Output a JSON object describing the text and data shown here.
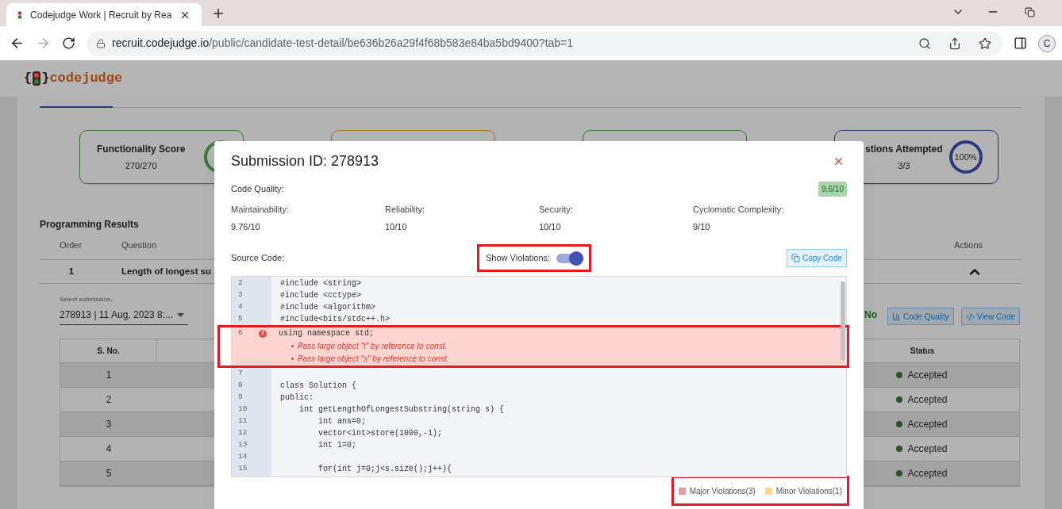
{
  "browser": {
    "tab_title": "Codejudge Work | Recruit by Rea",
    "url_host": "recruit.codejudge.io",
    "url_path": "/public/candidate-test-detail/be636b26a29f4f68b583e84ba5bd9400?tab=1",
    "forward_disabled": true,
    "profile_initial": "C"
  },
  "page": {
    "logo": {
      "open": "{",
      "close": "}",
      "name": "codejudge"
    },
    "score_cards": [
      {
        "title": "Functionality Score",
        "value": "270/270",
        "color": "#357a38"
      },
      {
        "color": "#a87016"
      },
      {
        "color": "#357a38"
      },
      {
        "title": "stions Attempted",
        "value": "3/3",
        "ring": "100%",
        "color": "#2c397f"
      }
    ],
    "section_title": "Programming Results",
    "results_columns": [
      "Order",
      "Question",
      "Actions"
    ],
    "results_row": {
      "order": "1",
      "question": "Length of longest su",
      "expanded": true
    },
    "submission_select": {
      "label": "Select submission..",
      "value": "278913 | 11 Aug, 2023 8:..."
    },
    "row_flag": "No",
    "action_buttons": [
      {
        "label": "Code Quality",
        "kind": "quality"
      },
      {
        "label": "View Code",
        "kind": "code"
      }
    ],
    "testcase_columns": [
      "S. No.",
      "Status"
    ],
    "testcase_rows": [
      {
        "s_no": "1",
        "status": "Accepted"
      },
      {
        "s_no": "2",
        "status": "Accepted"
      },
      {
        "s_no": "3",
        "status": "Accepted"
      },
      {
        "s_no": "4",
        "status": "Accepted"
      },
      {
        "s_no": "5",
        "status": "Accepted"
      }
    ]
  },
  "modal": {
    "title": "Submission ID: 278913",
    "code_quality_label": "Code Quality:",
    "code_quality_score": "9.6/10",
    "metrics": [
      {
        "label": "Maintainability:",
        "value": "9.76/10"
      },
      {
        "label": "Reliability:",
        "value": "10/10"
      },
      {
        "label": "Security:",
        "value": "10/10"
      },
      {
        "label": "Cyclomatic Complexity:",
        "value": "9/10"
      }
    ],
    "source_label": "Source Code:",
    "show_violations": {
      "label": "Show Violations:",
      "on": true
    },
    "copy_button": "Copy Code",
    "code_lines": [
      {
        "kind": "plain",
        "number": "2",
        "code": "#include <string>"
      },
      {
        "kind": "plain",
        "number": "3",
        "code": "#include <cctype>"
      },
      {
        "kind": "plain",
        "number": "4",
        "code": "#include <algorithm>"
      },
      {
        "kind": "plain",
        "number": "5",
        "code": "#include<bits/stdc++.h>"
      },
      {
        "kind": "violation",
        "number": "6",
        "code": "using namespace std;",
        "count": "2",
        "violations": [
          "Pass large object \"t\" by reference to const.",
          "Pass large object \"s\" by reference to const."
        ]
      },
      {
        "kind": "plain",
        "number": "7"
      },
      {
        "kind": "plain",
        "number": "8",
        "code": "class Solution {"
      },
      {
        "kind": "plain",
        "number": "9",
        "code": "public:"
      },
      {
        "kind": "plain",
        "number": "10",
        "code": "    int getLengthOfLongestSubstring(string s) {"
      },
      {
        "kind": "plain",
        "number": "11",
        "code": "        int ans=0;"
      },
      {
        "kind": "plain",
        "number": "12",
        "code": "        vector<int>store(1000,-1);"
      },
      {
        "kind": "plain",
        "number": "13",
        "code": "        int i=0;"
      },
      {
        "kind": "plain",
        "number": "14"
      },
      {
        "kind": "plain",
        "number": "15",
        "code": "        for(int j=0;j<s.size();j++){"
      }
    ],
    "legend": [
      {
        "label": "Major Violations(3)",
        "color": "#f1959f"
      },
      {
        "label": "Minor Violations(1)",
        "color": "#fad88f"
      }
    ]
  }
}
